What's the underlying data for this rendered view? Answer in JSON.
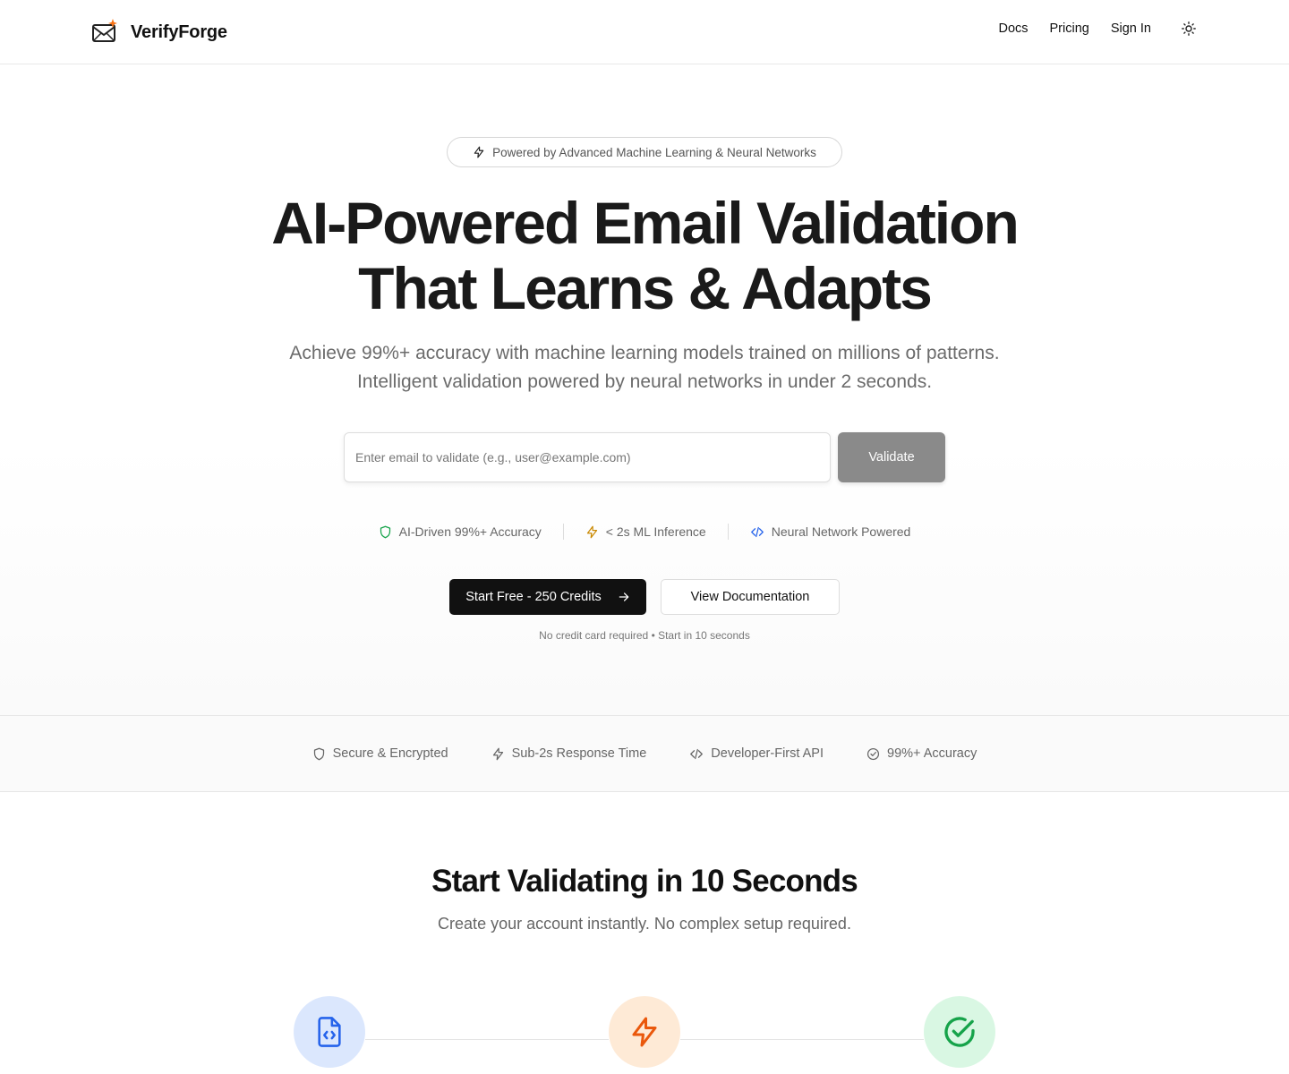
{
  "header": {
    "brand": "VerifyForge",
    "nav": [
      {
        "label": "Docs"
      },
      {
        "label": "Pricing"
      },
      {
        "label": "Sign In"
      }
    ],
    "theme_toggle_icon": "sun-icon"
  },
  "hero": {
    "badge_icon": "lightning-icon",
    "badge": "Powered by Advanced Machine Learning & Neural Networks",
    "headline_line1": "AI-Powered Email Validation",
    "headline_line2": "That Learns & Adapts",
    "subhead_line1": "Achieve 99%+ accuracy with machine learning models trained on millions of patterns.",
    "subhead_line2": "Intelligent validation powered by neural networks in under 2 seconds.",
    "input_value": "",
    "input_placeholder": "Enter email to validate (e.g., user@example.com)",
    "validate_label": "Validate",
    "features": [
      {
        "icon": "shield-icon",
        "label": "AI-Driven 99%+ Accuracy",
        "color": "#16a34a"
      },
      {
        "icon": "lightning-icon",
        "label": "< 2s ML Inference",
        "color": "#ca8a04"
      },
      {
        "icon": "code-icon",
        "label": "Neural Network Powered",
        "color": "#2563eb"
      }
    ],
    "cta_primary": "Start Free - 250 Credits",
    "cta_primary_icon": "arrow-right-icon",
    "cta_secondary": "View Documentation",
    "note": "No credit card required • Start in 10 seconds"
  },
  "trust": [
    {
      "icon": "shield-icon",
      "label": "Secure & Encrypted"
    },
    {
      "icon": "lightning-icon",
      "label": "Sub-2s Response Time"
    },
    {
      "icon": "code-icon",
      "label": "Developer-First API"
    },
    {
      "icon": "check-circle-icon",
      "label": "99%+ Accuracy"
    }
  ],
  "steps": {
    "title": "Start Validating in 10 Seconds",
    "subtitle": "Create your account instantly. No complex setup required.",
    "icons": [
      {
        "icon": "file-code-icon",
        "color": "#2563eb",
        "bg": "#dbe7fd"
      },
      {
        "icon": "lightning-icon",
        "color": "#ea580c",
        "bg": "#feead6"
      },
      {
        "icon": "check-circle-icon",
        "color": "#16a34a",
        "bg": "#d9f7e3"
      }
    ]
  },
  "colors": {
    "accent_dark": "#111111",
    "validate_disabled": "#8a8a8a",
    "logo_spark": "#f97316"
  }
}
